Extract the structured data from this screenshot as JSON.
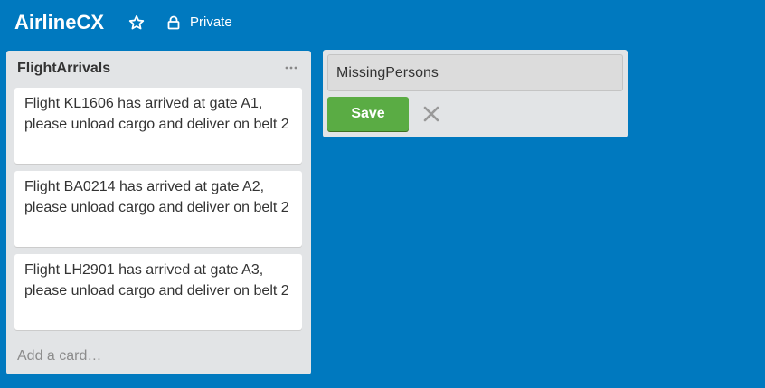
{
  "board": {
    "title": "AirlineCX",
    "visibility": "Private",
    "star_icon": "star-outline-icon",
    "lock_icon": "lock-icon",
    "background": "#0079bf"
  },
  "list": {
    "title": "FlightArrivals",
    "menu_icon": "ellipsis-icon",
    "cards": [
      {
        "text": "Flight KL1606 has arrived at gate A1, please unload cargo and deliver on belt 2"
      },
      {
        "text": "Flight BA0214 has arrived at gate A2, please unload cargo and deliver on belt 2"
      },
      {
        "text": "Flight LH2901 has arrived at gate A3, please unload cargo and deliver on belt 2"
      }
    ],
    "add_card_label": "Add a card…"
  },
  "add_list": {
    "input_value": "MissingPersons",
    "save_label": "Save",
    "close_icon": "close-icon",
    "save_color": "#5aac44"
  }
}
